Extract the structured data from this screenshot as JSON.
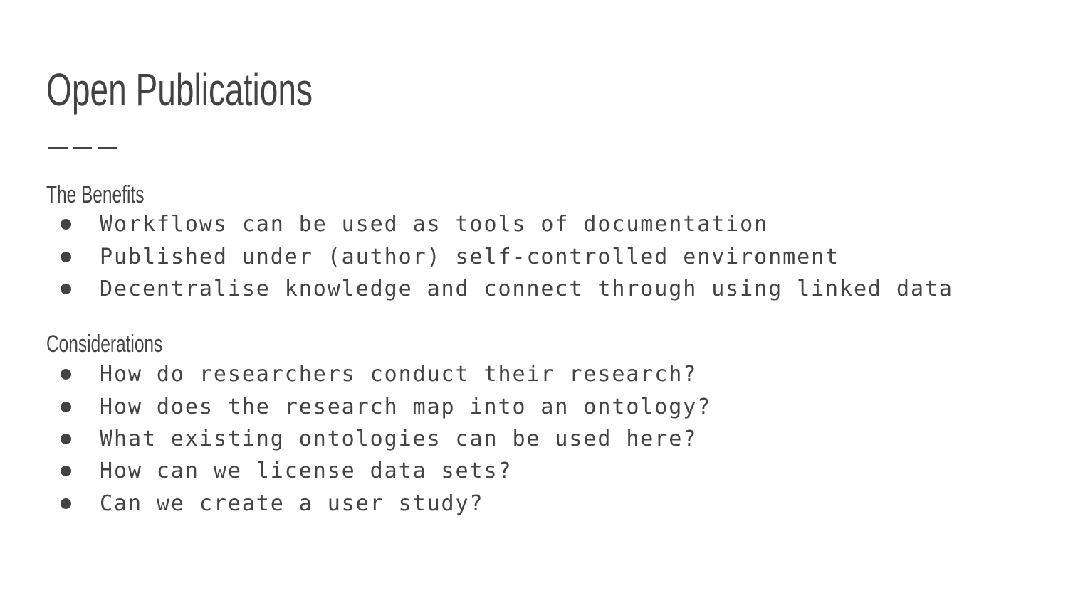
{
  "slide": {
    "title": "Open Publications",
    "sections": [
      {
        "heading": "The Benefits",
        "items": [
          "Workflows can be used as tools of documentation",
          "Published under (author) self-controlled environment",
          "Decentralise knowledge and connect through using linked data"
        ]
      },
      {
        "heading": "Considerations",
        "items": [
          "How do researchers conduct their research?",
          "How does the research map into an ontology?",
          "What existing ontologies can be used here?",
          "How can we license data sets?",
          "Can we create a user study?"
        ]
      }
    ]
  },
  "colors": {
    "text": "#434343",
    "background": "#ffffff"
  }
}
